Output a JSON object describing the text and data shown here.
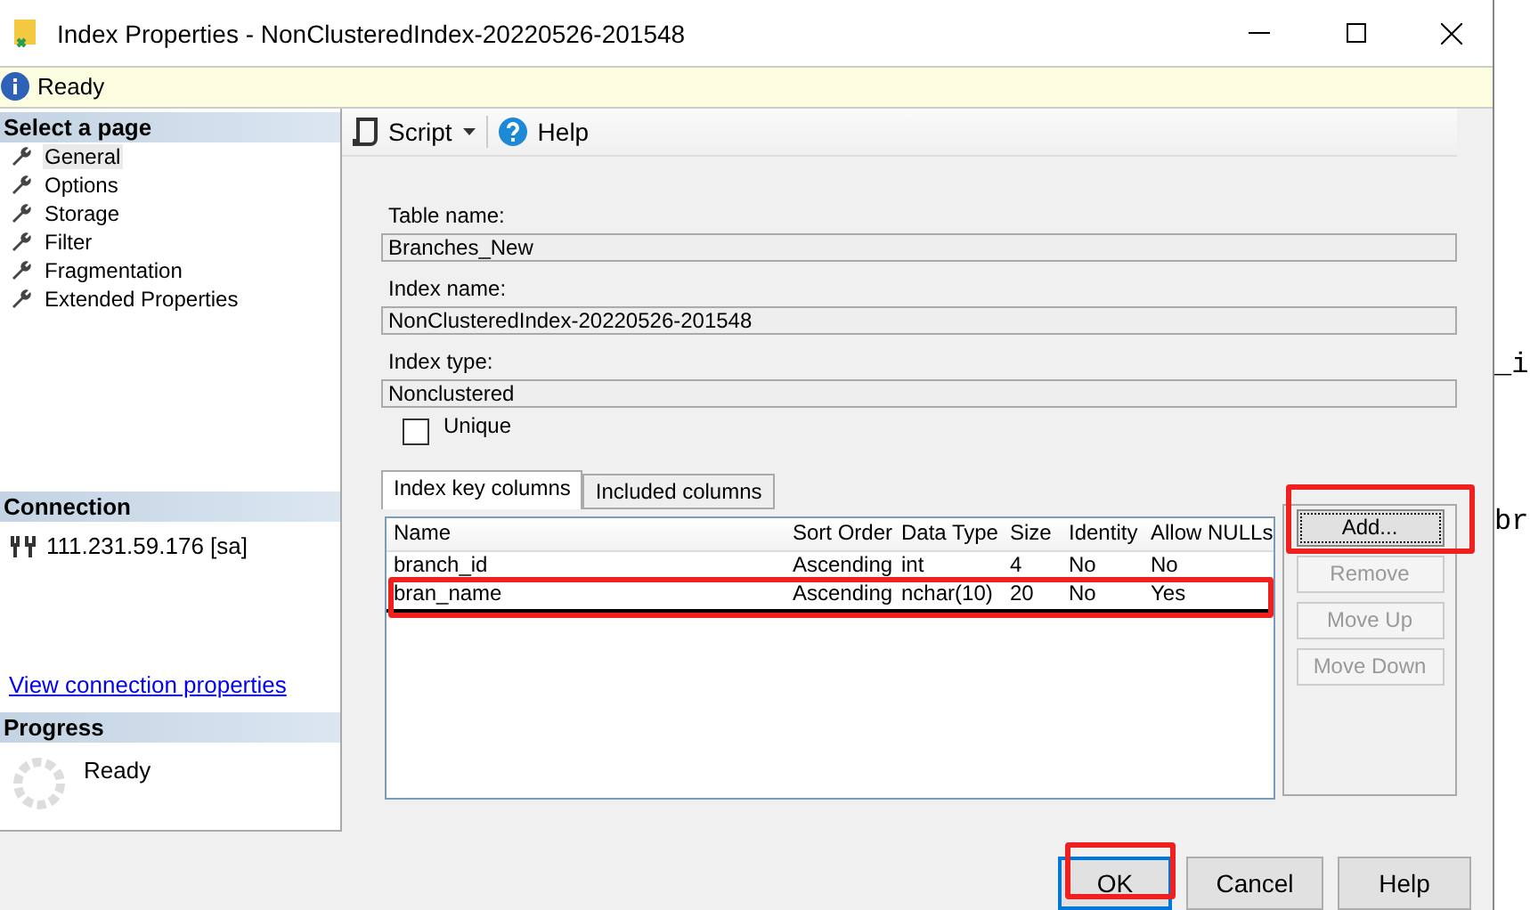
{
  "window": {
    "title": "Index Properties - NonClusteredIndex-20220526-201548"
  },
  "info_bar": {
    "text": "Ready"
  },
  "sidebar": {
    "heading": "Select a page",
    "items": [
      {
        "label": "General",
        "selected": true
      },
      {
        "label": "Options",
        "selected": false
      },
      {
        "label": "Storage",
        "selected": false
      },
      {
        "label": "Filter",
        "selected": false
      },
      {
        "label": "Fragmentation",
        "selected": false
      },
      {
        "label": "Extended Properties",
        "selected": false
      }
    ]
  },
  "connection": {
    "heading": "Connection",
    "server": "111.231.59.176 [sa]",
    "link": "View connection properties"
  },
  "progress": {
    "heading": "Progress",
    "status": "Ready"
  },
  "toolbar": {
    "script": "Script",
    "help": "Help"
  },
  "fields": [
    {
      "label": "Table name:",
      "value": "Branches_New"
    },
    {
      "label": "Index name:",
      "value": "NonClusteredIndex-20220526-201548"
    },
    {
      "label": "Index type:",
      "value": "Nonclustered"
    }
  ],
  "unique": {
    "label": "Unique",
    "checked": false
  },
  "tabs": [
    {
      "label": "Index key columns",
      "selected": true
    },
    {
      "label": "Included columns",
      "selected": false
    }
  ],
  "table": {
    "columns": [
      "Name",
      "Sort Order",
      "Data Type",
      "Size",
      "Identity",
      "Allow NULLs"
    ],
    "rows": [
      {
        "cells": [
          "branch_id",
          "Ascending",
          "int",
          "4",
          "No",
          "No"
        ],
        "focused": false
      },
      {
        "cells": [
          "bran_name",
          "Ascending",
          "nchar(10)",
          "20",
          "No",
          "Yes"
        ],
        "focused": true
      }
    ]
  },
  "side_buttons": [
    {
      "label": "Add...",
      "disabled": false
    },
    {
      "label": "Remove",
      "disabled": true
    },
    {
      "label": "Move Up",
      "disabled": true
    },
    {
      "label": "Move Down",
      "disabled": true
    }
  ],
  "footer_buttons": [
    {
      "label": "OK",
      "default": true
    },
    {
      "label": "Cancel",
      "default": false
    },
    {
      "label": "Help",
      "default": false
    }
  ],
  "background_window": {
    "lines": [
      "_i",
      "br"
    ]
  }
}
